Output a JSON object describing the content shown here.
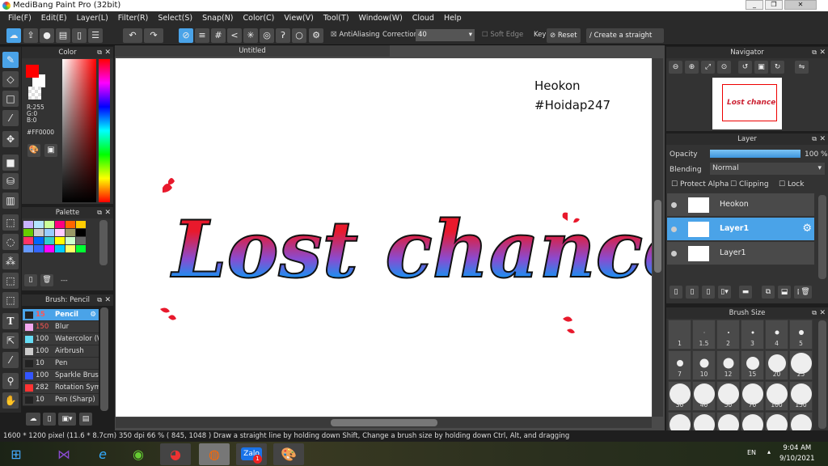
{
  "window": {
    "title": "MediBang Paint Pro (32bit)"
  },
  "menu": [
    "File(F)",
    "Edit(E)",
    "Layer(L)",
    "Filter(R)",
    "Select(S)",
    "Snap(N)",
    "Color(C)",
    "View(V)",
    "Tool(T)",
    "Window(W)",
    "Cloud",
    "Help"
  ],
  "toolbar": {
    "antialiasing": "AntiAliasing",
    "correction_label": "Correction",
    "correction_value": "40",
    "soft_edge": "Soft Edge",
    "key": "Key",
    "reset": "Reset",
    "straight_line": "Create a straight line"
  },
  "canvas": {
    "tab": "Untitled",
    "text_line1": "Heokon",
    "text_line2": "#Hoidap247",
    "lettering": "Lost chance"
  },
  "color_panel": {
    "title": "Color",
    "r": "R:255",
    "g": "G:0",
    "b": "B:0",
    "hex": "#FF0000",
    "foreground": "#FF0000",
    "background": "#FFFFFF"
  },
  "palette_panel": {
    "title": "Palette",
    "name": "---",
    "colors": [
      "#c9b3ff",
      "#b3e5ff",
      "#ccff99",
      "#ff0080",
      "#ff6600",
      "#ffcc00",
      "#66cc00",
      "#cccccc",
      "#99ccff",
      "#ffccff",
      "#999966",
      "#000000",
      "#ff3366",
      "#0066ff",
      "#33cccc",
      "#ffff00",
      "#ccffcc",
      "#666666",
      "#6699ff",
      "#3366ff",
      "#ff00ff",
      "#00ccff",
      "#ffff66",
      "#00ff33"
    ]
  },
  "brush_panel": {
    "title": "Brush: Pencil",
    "items": [
      {
        "size": "15",
        "name": "Pencil",
        "color": "#222222"
      },
      {
        "size": "150",
        "name": "Blur",
        "color": "#f5a8f0"
      },
      {
        "size": "100",
        "name": "Watercolor (Wet)",
        "color": "#66ddf5"
      },
      {
        "size": "100",
        "name": "Airbrush",
        "color": "#cccccc"
      },
      {
        "size": "10",
        "name": "Pen",
        "color": "#222222"
      },
      {
        "size": "100",
        "name": "Sparkle Brush",
        "color": "#3355ff"
      },
      {
        "size": "282",
        "name": "Rotation Symmetry",
        "color": "#ff3333"
      },
      {
        "size": "10",
        "name": "Pen (Sharp)",
        "color": "#222222"
      }
    ]
  },
  "navigator": {
    "title": "Navigator"
  },
  "layer_panel": {
    "title": "Layer",
    "opacity_label": "Opacity",
    "opacity_value": "100 %",
    "opacity": 100,
    "blending_label": "Blending",
    "blending_value": "Normal",
    "protect_alpha": "Protect Alpha",
    "clipping": "Clipping",
    "lock": "Lock",
    "layers": [
      {
        "name": "Heokon",
        "selected": false
      },
      {
        "name": "Layer1",
        "selected": true
      },
      {
        "name": "Layer1",
        "selected": false
      }
    ]
  },
  "brush_size_panel": {
    "title": "Brush Size",
    "sizes": [
      "1",
      "1.5",
      "2",
      "3",
      "4",
      "5",
      "7",
      "10",
      "12",
      "15",
      "20",
      "25",
      "30",
      "40",
      "50",
      "70",
      "100",
      "150",
      "",
      "",
      "",
      "",
      "",
      ""
    ]
  },
  "status": {
    "text": "1600 * 1200 pixel  (11.6 * 8.7cm)  350 dpi  66 %  ( 845, 1048 )  Draw a straight line by holding down Shift, Change a brush size by holding down Ctrl, Alt, and dragging"
  },
  "taskbar": {
    "lang": "EN",
    "time": "9:04 AM",
    "date": "9/10/2021",
    "zalo_badge": "1",
    "zalo": "Zalo"
  }
}
